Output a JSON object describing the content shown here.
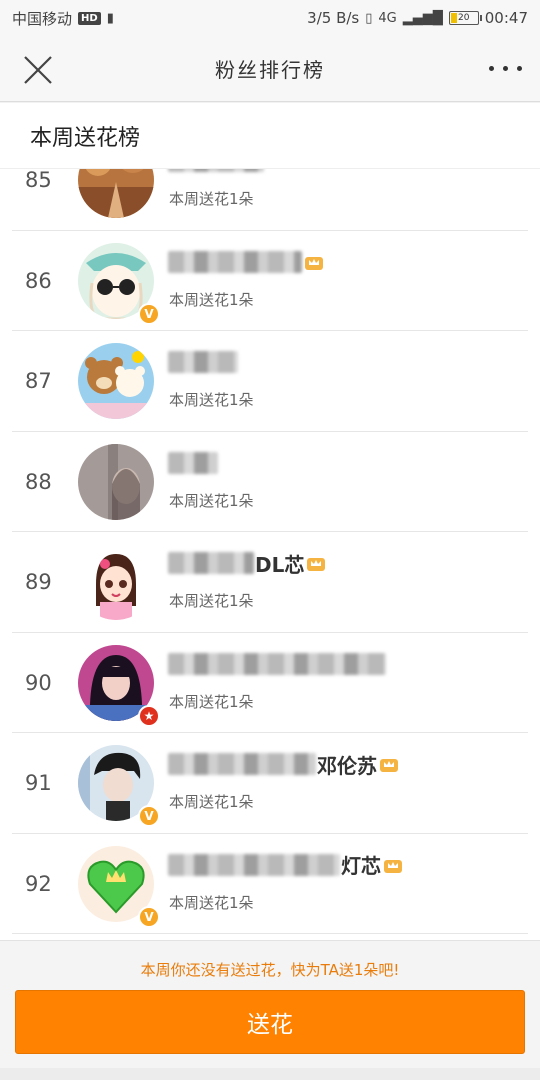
{
  "status_bar": {
    "carrier": "中国移动",
    "hd": "HD",
    "speed": "3/5 B/s",
    "network": "4G",
    "battery": "20",
    "time": "00:47"
  },
  "nav": {
    "title": "粉丝排行榜"
  },
  "section": {
    "title": "本周送花榜"
  },
  "rows": [
    {
      "rank": "85",
      "name_suffix": "",
      "sub": "本周送花1朵",
      "badge": ""
    },
    {
      "rank": "86",
      "name_suffix": "",
      "sub": "本周送花1朵",
      "badge": "V"
    },
    {
      "rank": "87",
      "name_suffix": "",
      "sub": "本周送花1朵",
      "badge": ""
    },
    {
      "rank": "88",
      "name_suffix": "",
      "sub": "本周送花1朵",
      "badge": ""
    },
    {
      "rank": "89",
      "name_suffix": "DL芯",
      "sub": "本周送花1朵",
      "badge": ""
    },
    {
      "rank": "90",
      "name_suffix": "",
      "sub": "本周送花1朵",
      "badge": "★"
    },
    {
      "rank": "91",
      "name_suffix": "邓伦苏",
      "sub": "本周送花1朵",
      "badge": "V"
    },
    {
      "rank": "92",
      "name_suffix": "灯芯",
      "sub": "本周送花1朵",
      "badge": "V"
    }
  ],
  "footer": {
    "hint": "本周你还没有送过花，快为TA送1朵吧!",
    "button_label": "送花"
  },
  "colors": {
    "accent": "#ff8200",
    "hint": "#e97c0a",
    "vip_badge": "#f6a623",
    "star_badge": "#e0301e"
  }
}
